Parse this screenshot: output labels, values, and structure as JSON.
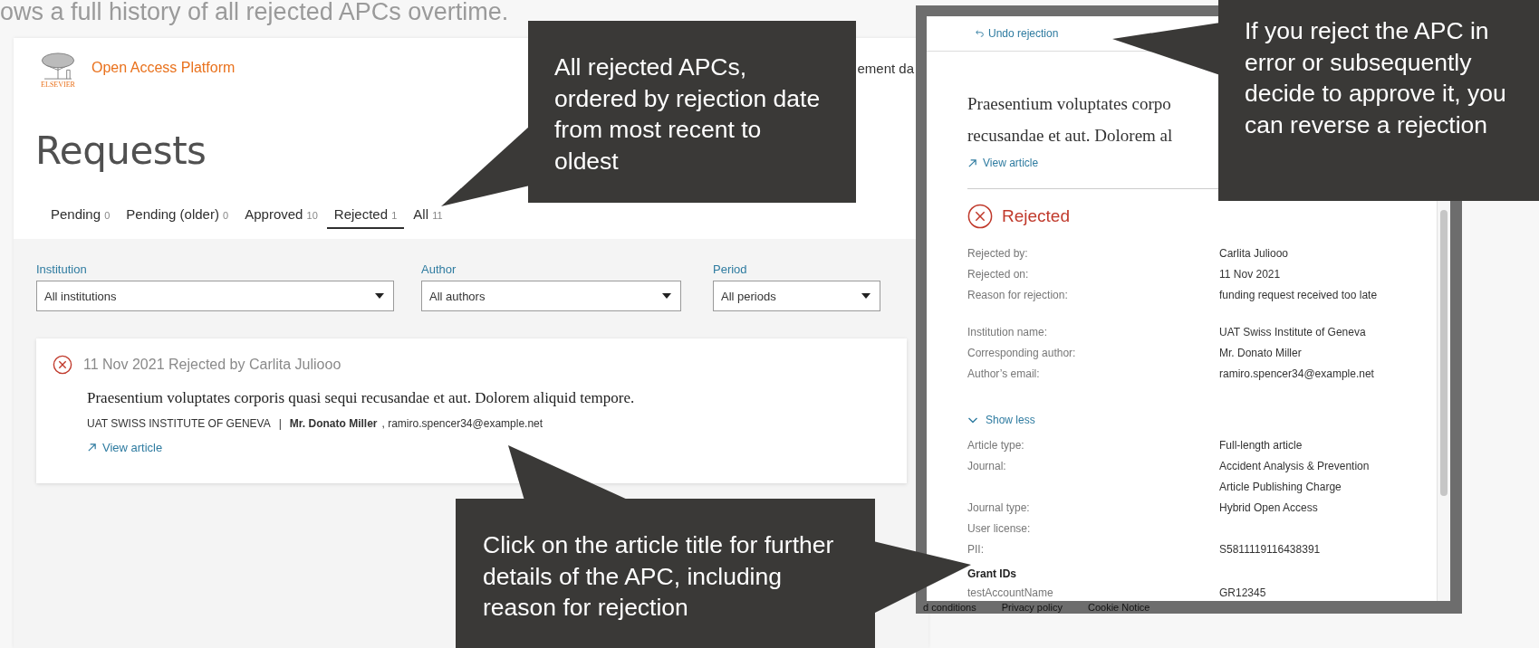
{
  "caption": "ows a full history of all rejected APCs overtime.",
  "app": {
    "brand": "ELSEVIER",
    "title": "Open Access Platform",
    "header_link": "ement da",
    "heading": "Requests",
    "tabs": [
      {
        "label": "Pending",
        "count": "0",
        "selected": false
      },
      {
        "label": "Pending (older)",
        "count": "0",
        "selected": false
      },
      {
        "label": "Approved",
        "count": "10",
        "selected": false
      },
      {
        "label": "Rejected",
        "count": "1",
        "selected": true
      },
      {
        "label": "All",
        "count": "11",
        "selected": false
      }
    ],
    "filters": [
      {
        "label": "Institution",
        "value": "All institutions"
      },
      {
        "label": "Author",
        "value": "All authors"
      },
      {
        "label": "Period",
        "value": "All periods"
      }
    ],
    "requests": [
      {
        "kind": "rejected",
        "date_line": "11 Nov 2021 Rejected by Carlita Juliooo",
        "title": "Praesentium voluptates corporis quasi sequi recusandae et aut. Dolorem aliquid tempore.",
        "institution": "UAT SWISS INSTITUTE OF GENEVA",
        "separator": "|",
        "author": "Mr. Donato Miller",
        "email": ", ramiro.spencer34@example.net",
        "link": "View article"
      }
    ],
    "footer": [
      "d conditions",
      "Privacy policy",
      "Cookie Notice"
    ]
  },
  "detail_panel": {
    "undo": "Undo rejection",
    "title_lines": [
      "Praesentium voluptates corpo",
      "recusandae et aut. Dolorem al"
    ],
    "link": "View article",
    "status": {
      "kind": "rejected",
      "label": "Rejected"
    },
    "groups": [
      [
        {
          "label": "Rejected by:",
          "values": [
            "Carlita Juliooo"
          ]
        },
        {
          "label": "Rejected on:",
          "values": [
            "11 Nov 2021"
          ]
        },
        {
          "label": "Reason for rejection:",
          "values": [
            "funding request received too late"
          ]
        }
      ],
      [
        {
          "label": "Institution name:",
          "values": [
            "UAT Swiss Institute of Geneva"
          ]
        },
        {
          "label": "Corresponding author:",
          "values": [
            "Mr. Donato Miller"
          ]
        },
        {
          "label": "Author’s email:",
          "values": [
            "ramiro.spencer34@example.net"
          ]
        }
      ]
    ],
    "toggle": {
      "label": "Show less",
      "expanded": true
    },
    "article_fields": [
      {
        "label": "Article type:",
        "values": [
          "Full-length article"
        ]
      },
      {
        "label": "Journal:",
        "values": [
          "Accident Analysis & Prevention",
          "Article Publishing Charge"
        ]
      },
      {
        "label": "Journal type:",
        "values": [
          "Hybrid Open Access"
        ]
      },
      {
        "label": "User license:"
      },
      {
        "label": "PII:",
        "values": [
          "S5811119116438391"
        ]
      }
    ],
    "grants": {
      "heading": "Grant IDs",
      "rows": [
        {
          "label": "testAccountName",
          "values": [
            "GR12345"
          ]
        }
      ]
    }
  },
  "callouts": [
    {
      "text": "All rejected APCs, ordered by rejection date from most recent to oldest"
    },
    {
      "text": "Click on the article title for further details of the APC, including reason for rejection"
    },
    {
      "text": "If you reject the APC in error or subsequently decide to approve it, you can reverse a rejection"
    }
  ]
}
